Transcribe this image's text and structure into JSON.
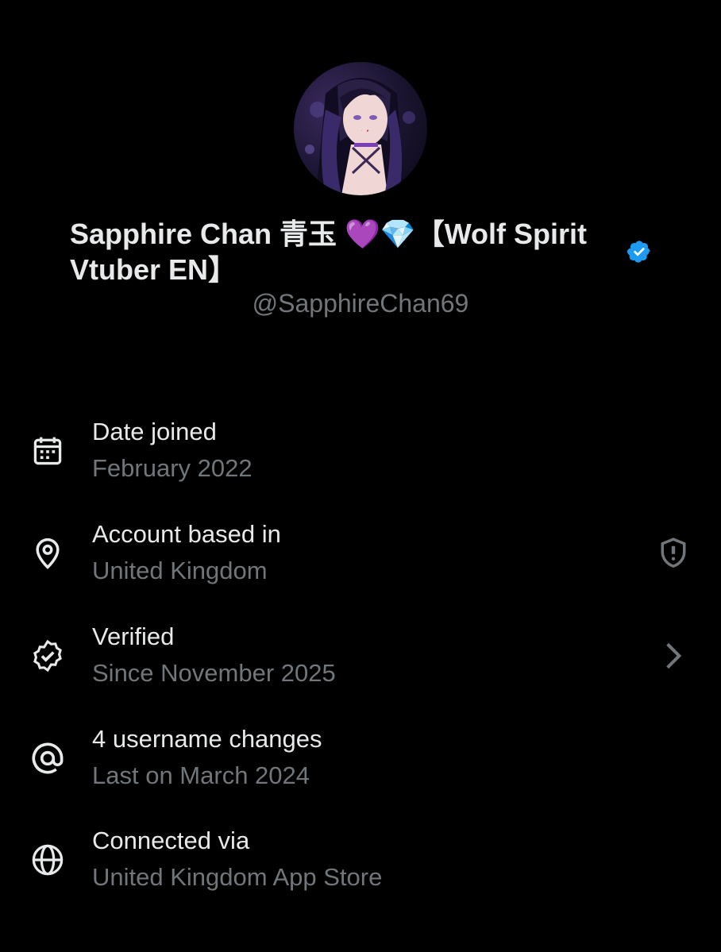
{
  "profile": {
    "name_line1": "Sapphire Chan 青玉 💜💎【Wolf Spirit",
    "name_line2": "Vtuber EN】",
    "handle": "@SapphireChan69"
  },
  "colors": {
    "background": "#000000",
    "primary_text": "#e7e9ea",
    "secondary_text": "#71767b",
    "verified_blue": "#1d9bf0"
  },
  "rows": [
    {
      "icon": "calendar-icon",
      "title": "Date joined",
      "subtitle": "February 2022"
    },
    {
      "icon": "location-pin-icon",
      "title": "Account based in",
      "subtitle": "United Kingdom",
      "trailing": "shield-alert-icon"
    },
    {
      "icon": "verified-check-icon",
      "title": "Verified",
      "subtitle": "Since November 2025",
      "trailing": "chevron-right-icon"
    },
    {
      "icon": "at-sign-icon",
      "title": "4 username changes",
      "subtitle": "Last on March 2024"
    },
    {
      "icon": "globe-icon",
      "title": "Connected via",
      "subtitle": "United Kingdom App Store"
    }
  ]
}
